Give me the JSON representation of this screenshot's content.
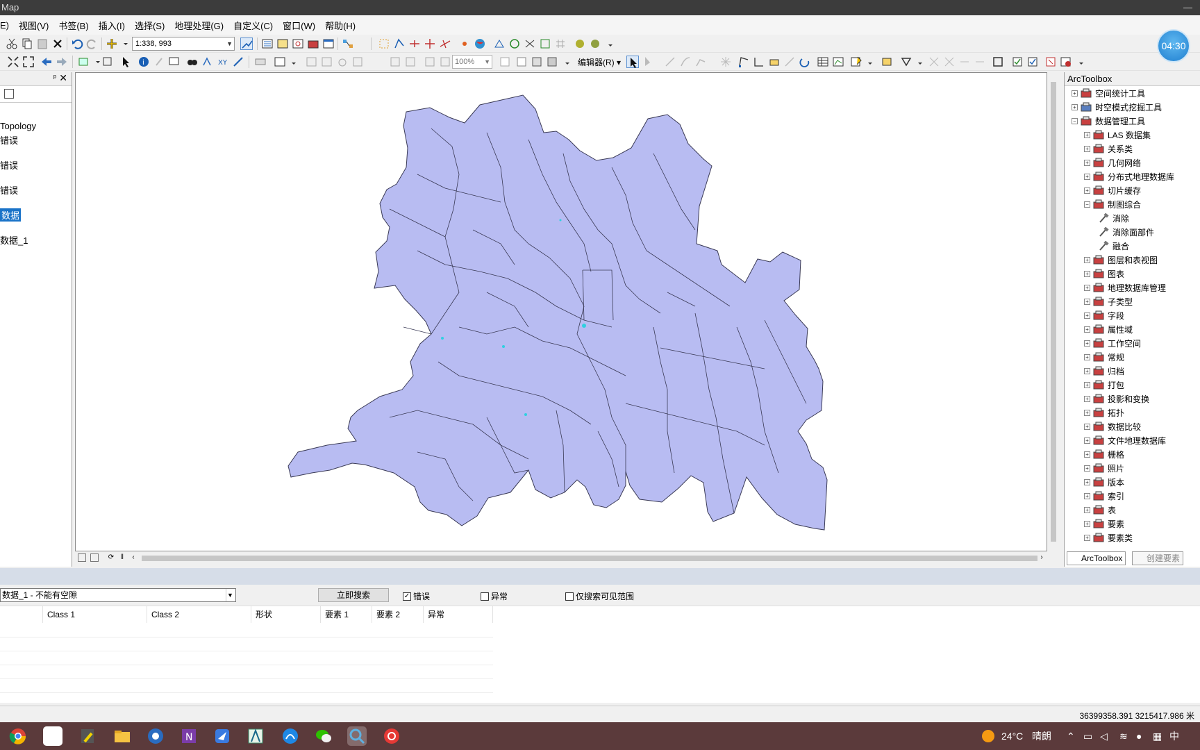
{
  "window": {
    "title": "Map",
    "minimize": "—"
  },
  "menu": {
    "items": [
      "E)",
      "视图(V)",
      "书签(B)",
      "插入(I)",
      "选择(S)",
      "地理处理(G)",
      "自定义(C)",
      "窗口(W)",
      "帮助(H)"
    ]
  },
  "toolbar": {
    "scale": "1:338, 993",
    "zoom": "100%",
    "editor_menu": "编辑器(R) ▾"
  },
  "clock": {
    "time": "04:30"
  },
  "toc": {
    "pin": "ᵖ",
    "close": "✕",
    "items": [
      "Topology",
      "错误",
      "错误",
      "错误",
      "数据",
      "数据_1"
    ]
  },
  "toolbox": {
    "title": "ArcToolbox",
    "items": [
      {
        "label": "空间统计工具",
        "state": "+"
      },
      {
        "label": "时空模式挖掘工具",
        "state": "+"
      },
      {
        "label": "数据管理工具",
        "state": "-"
      },
      {
        "label": "LAS 数据集",
        "state": "+"
      },
      {
        "label": "关系类",
        "state": "+"
      },
      {
        "label": "几何网络",
        "state": "+"
      },
      {
        "label": "分布式地理数据库",
        "state": "+"
      },
      {
        "label": "切片缓存",
        "state": "+"
      },
      {
        "label": "制图综合",
        "state": "-"
      },
      {
        "label": "消除",
        "state": "tool"
      },
      {
        "label": "消除面部件",
        "state": "tool"
      },
      {
        "label": "融合",
        "state": "tool"
      },
      {
        "label": "图层和表视图",
        "state": "+"
      },
      {
        "label": "图表",
        "state": "+"
      },
      {
        "label": "地理数据库管理",
        "state": "+"
      },
      {
        "label": "子类型",
        "state": "+"
      },
      {
        "label": "字段",
        "state": "+"
      },
      {
        "label": "属性域",
        "state": "+"
      },
      {
        "label": "工作空间",
        "state": "+"
      },
      {
        "label": "常规",
        "state": "+"
      },
      {
        "label": "归档",
        "state": "+"
      },
      {
        "label": "打包",
        "state": "+"
      },
      {
        "label": "投影和变换",
        "state": "+"
      },
      {
        "label": "拓扑",
        "state": "+"
      },
      {
        "label": "数据比较",
        "state": "+"
      },
      {
        "label": "文件地理数据库",
        "state": "+"
      },
      {
        "label": "栅格",
        "state": "+"
      },
      {
        "label": "照片",
        "state": "+"
      },
      {
        "label": "版本",
        "state": "+"
      },
      {
        "label": "索引",
        "state": "+"
      },
      {
        "label": "表",
        "state": "+"
      },
      {
        "label": "要素",
        "state": "+"
      },
      {
        "label": "要素类",
        "state": "+"
      }
    ],
    "tabs": [
      "ArcToolbox",
      "创建要素"
    ]
  },
  "inspector": {
    "rule_select": "数据_1 - 不能有空隙",
    "search_button": "立即搜索",
    "check_errors": "错误",
    "check_exceptions": "异常",
    "check_visible_only": "仅搜索可见范围",
    "columns": [
      "Class 1",
      "Class 2",
      "形状",
      "要素 1",
      "要素 2",
      "异常"
    ]
  },
  "status": {
    "coords": "36399358.391  3215417.986 米"
  },
  "tray": {
    "temp": "24°C",
    "weather": "晴朗",
    "ime": "中"
  },
  "colors": {
    "polygon_fill": "#b8bcf2",
    "polygon_stroke": "#3a3a55",
    "error_marker": "#2fd0e0",
    "selection": "#1a73c8"
  }
}
